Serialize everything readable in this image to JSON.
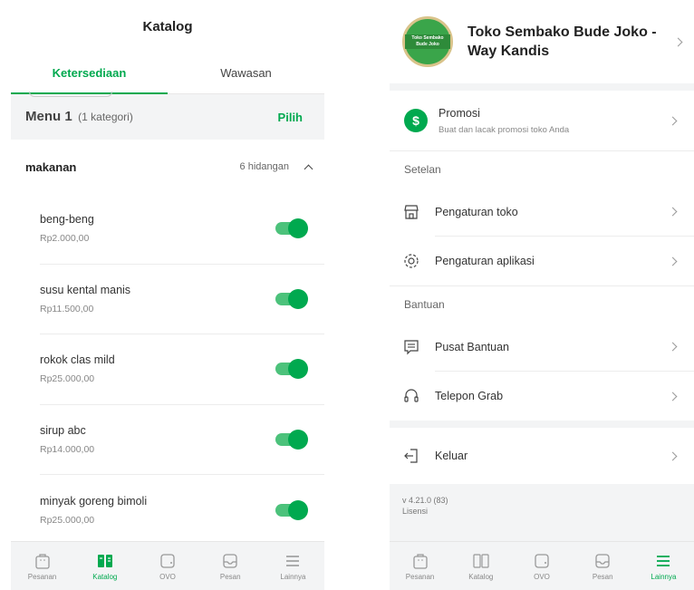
{
  "left": {
    "header_title": "Katalog",
    "tabs": [
      {
        "label": "Ketersediaan",
        "active": true
      },
      {
        "label": "Wawasan",
        "active": false
      }
    ],
    "menu": {
      "title": "Menu 1",
      "subtitle": "(1 kategori)",
      "action": "Pilih"
    },
    "category": {
      "name": "makanan",
      "count": "6 hidangan"
    },
    "items": [
      {
        "name": "beng-beng",
        "price": "Rp2.000,00",
        "enabled": true
      },
      {
        "name": "susu kental manis",
        "price": "Rp11.500,00",
        "enabled": true
      },
      {
        "name": "rokok clas mild",
        "price": "Rp25.000,00",
        "enabled": true
      },
      {
        "name": "sirup abc",
        "price": "Rp14.000,00",
        "enabled": true
      },
      {
        "name": "minyak goreng bimoli",
        "price": "Rp25.000,00",
        "enabled": true
      }
    ],
    "nav": [
      {
        "label": "Pesanan",
        "icon": "bag-icon",
        "active": false
      },
      {
        "label": "Katalog",
        "icon": "catalog-icon",
        "active": true
      },
      {
        "label": "OVO",
        "icon": "wallet-icon",
        "active": false
      },
      {
        "label": "Pesan",
        "icon": "inbox-icon",
        "active": false
      },
      {
        "label": "Lainnya",
        "icon": "menu-icon",
        "active": false
      }
    ]
  },
  "right": {
    "store": {
      "name": "Toko Sembako Bude Joko - Way Kandis",
      "avatar_text": "Toko Sembako Bude Joko"
    },
    "promo": {
      "title": "Promosi",
      "subtitle": "Buat dan lacak promosi toko Anda",
      "icon_text": "$"
    },
    "settings": {
      "title": "Setelan",
      "items": [
        {
          "label": "Pengaturan toko",
          "icon": "store-icon"
        },
        {
          "label": "Pengaturan aplikasi",
          "icon": "gear-icon"
        }
      ]
    },
    "help": {
      "title": "Bantuan",
      "items": [
        {
          "label": "Pusat Bantuan",
          "icon": "chat-icon"
        },
        {
          "label": "Telepon Grab",
          "icon": "headset-icon"
        }
      ]
    },
    "logout": {
      "label": "Keluar",
      "icon": "logout-icon"
    },
    "version": "v 4.21.0 (83)",
    "license": "Lisensi",
    "nav": [
      {
        "label": "Pesanan",
        "icon": "bag-icon",
        "active": false
      },
      {
        "label": "Katalog",
        "icon": "catalog-icon",
        "active": false
      },
      {
        "label": "OVO",
        "icon": "wallet-icon",
        "active": false
      },
      {
        "label": "Pesan",
        "icon": "inbox-icon",
        "active": false
      },
      {
        "label": "Lainnya",
        "icon": "menu-icon",
        "active": true
      }
    ]
  },
  "colors": {
    "accent": "#00a94f",
    "background": "#f3f4f5"
  }
}
